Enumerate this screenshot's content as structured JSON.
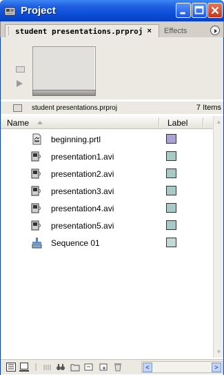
{
  "window": {
    "title": "Project",
    "accent": "#0a4bd8"
  },
  "tabs": [
    {
      "label": "student presentations.prproj",
      "close": "×",
      "active": true
    },
    {
      "label": "Effects",
      "active": false
    }
  ],
  "info": {
    "project_name": "student presentations.prproj",
    "item_count": "7 Items"
  },
  "columns": {
    "name": "Name",
    "label": "Label"
  },
  "items": [
    {
      "name": "beginning.prtl",
      "icon": "title-file-icon",
      "label_color": "#a8a3d2"
    },
    {
      "name": "presentation1.avi",
      "icon": "video-file-icon",
      "label_color": "#a9c9c6"
    },
    {
      "name": "presentation2.avi",
      "icon": "video-file-icon",
      "label_color": "#a9c9c6"
    },
    {
      "name": "presentation3.avi",
      "icon": "video-file-icon",
      "label_color": "#a9c9c6"
    },
    {
      "name": "presentation4.avi",
      "icon": "video-file-icon",
      "label_color": "#a9c9c6"
    },
    {
      "name": "presentation5.avi",
      "icon": "video-file-icon",
      "label_color": "#a9c9c6"
    },
    {
      "name": "Sequence 01",
      "icon": "sequence-icon",
      "label_color": "#c2d9d5"
    }
  ]
}
